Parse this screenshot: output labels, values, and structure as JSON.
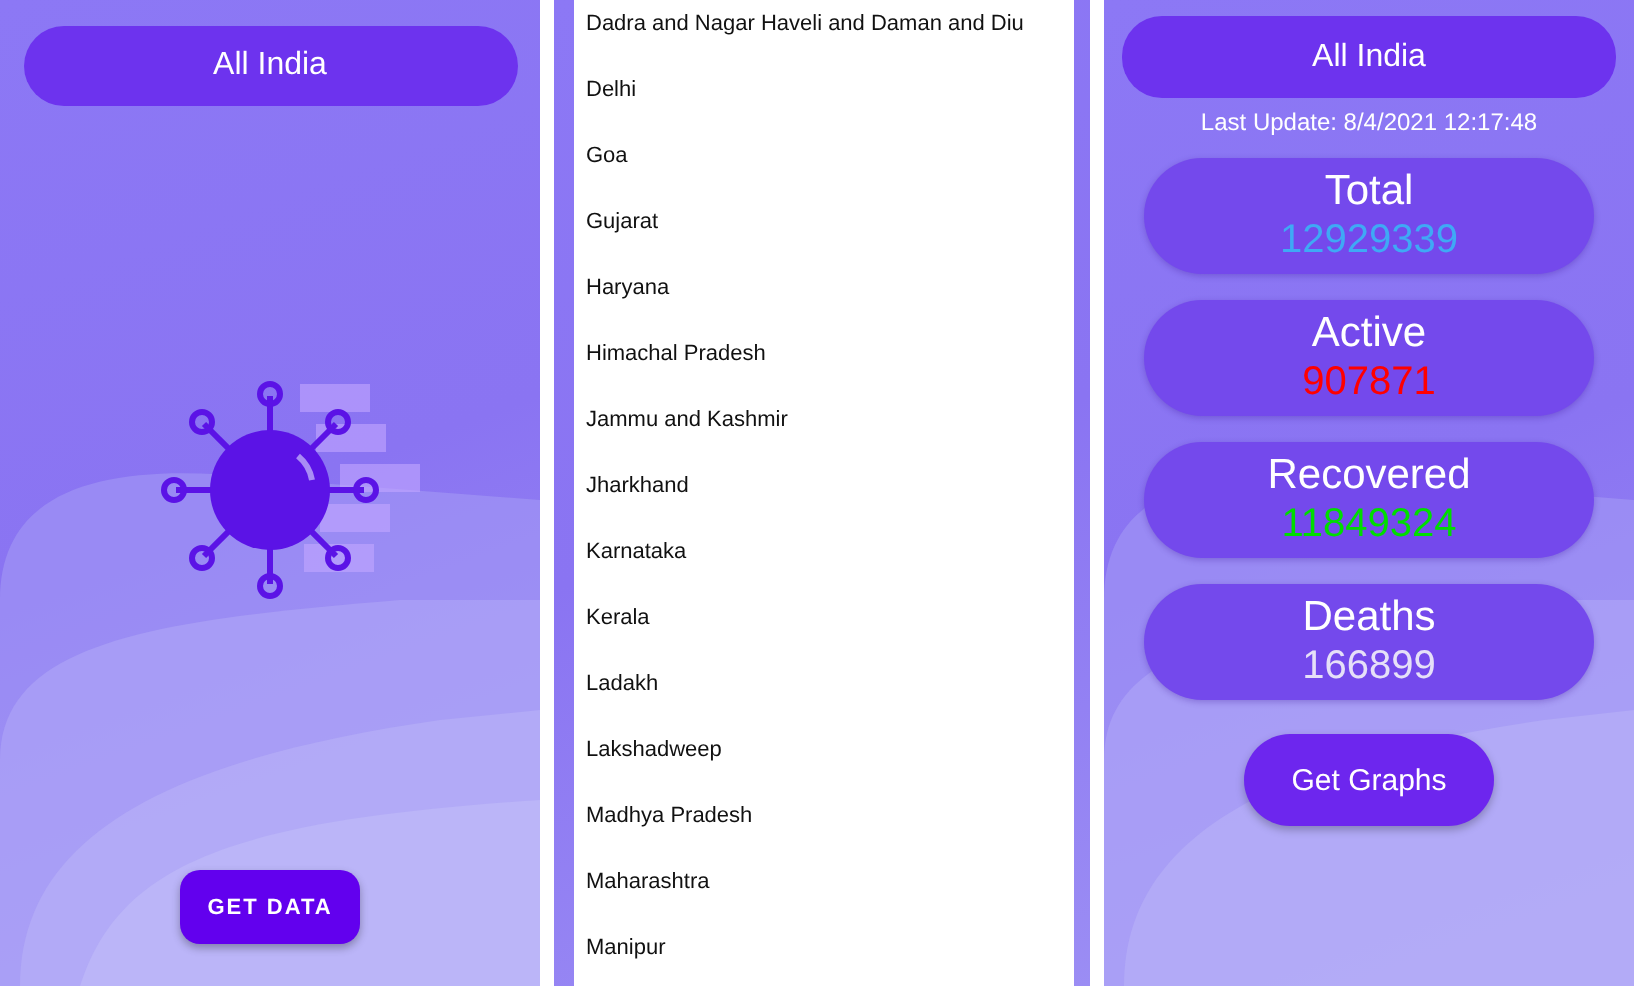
{
  "home_screen": {
    "region_button": "All India",
    "action_button": "GET DATA"
  },
  "region_list": {
    "items": [
      {
        "label": "Dadra and Nagar Haveli and Daman and Diu"
      },
      {
        "label": "Delhi"
      },
      {
        "label": "Goa"
      },
      {
        "label": "Gujarat"
      },
      {
        "label": "Haryana"
      },
      {
        "label": "Himachal Pradesh"
      },
      {
        "label": "Jammu and Kashmir"
      },
      {
        "label": "Jharkhand"
      },
      {
        "label": "Karnataka"
      },
      {
        "label": "Kerala"
      },
      {
        "label": "Ladakh"
      },
      {
        "label": "Lakshadweep"
      },
      {
        "label": "Madhya Pradesh"
      },
      {
        "label": "Maharashtra"
      },
      {
        "label": "Manipur"
      }
    ]
  },
  "stats_screen": {
    "region_button": "All India",
    "last_update": "Last Update: 8/4/2021 12:17:48",
    "stats": [
      {
        "label": "Total",
        "value": "12929339",
        "color": "#3fa9f5"
      },
      {
        "label": "Active",
        "value": "907871",
        "color": "#ff0000"
      },
      {
        "label": "Recovered",
        "value": "11849324",
        "color": "#00dd00"
      },
      {
        "label": "Deaths",
        "value": "166899",
        "color": "#e6e0f8"
      }
    ],
    "graphs_button": "Get Graphs"
  }
}
